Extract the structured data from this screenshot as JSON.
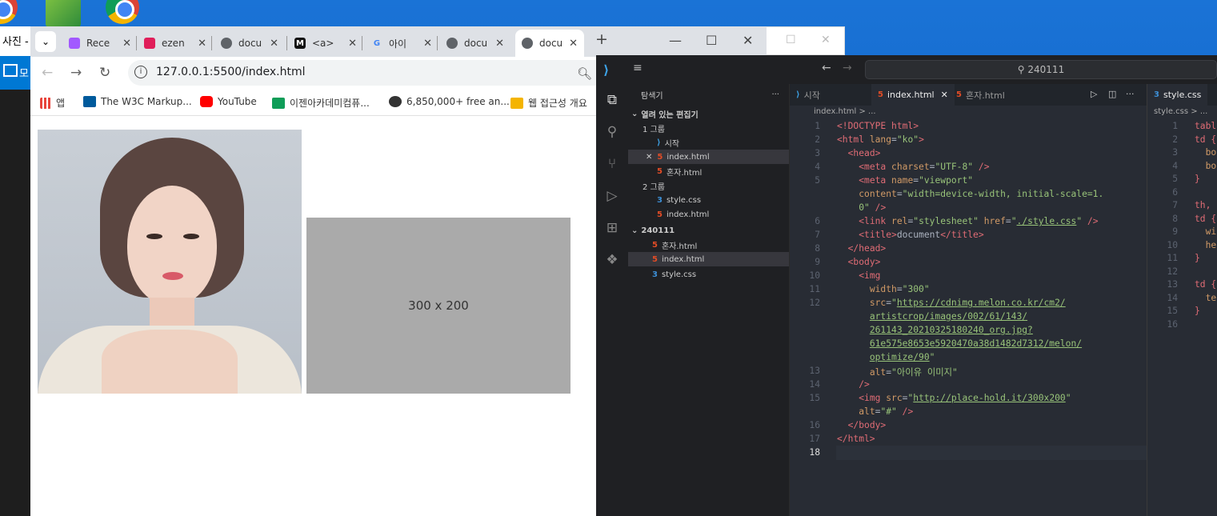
{
  "desktop": {
    "photo_app_title": "사진 -",
    "photo_app_bar": "모"
  },
  "chrome": {
    "tabs": [
      {
        "label": "Rece",
        "icon": "figma-icon",
        "color": "#a259ff"
      },
      {
        "label": "ezen",
        "icon": "slack-icon",
        "color": "#e01e5a"
      },
      {
        "label": "docu",
        "icon": "globe-icon",
        "color": "#5f6368"
      },
      {
        "label": "<a>",
        "icon": "m-icon",
        "color": "#111111"
      },
      {
        "label": "아이",
        "icon": "google-icon",
        "color": "#4285f4"
      },
      {
        "label": "docu",
        "icon": "globe-icon",
        "color": "#5f6368"
      },
      {
        "label": "docu",
        "icon": "globe-icon",
        "color": "#5f6368"
      }
    ],
    "url": "127.0.0.1:5500/index.html",
    "bookmarks": [
      {
        "label": "앱",
        "color": "#e8453c"
      },
      {
        "label": "The W3C Markup...",
        "color": "#005a9c"
      },
      {
        "label": "YouTube",
        "color": "#ff0000"
      },
      {
        "label": "이젠아카데미컴퓨...",
        "color": "#0f9d58"
      },
      {
        "label": "6,850,000+ free an...",
        "color": "#333333"
      },
      {
        "label": "웹 접근성 개요",
        "color": "#f4b400"
      }
    ],
    "page": {
      "placeholder_text": "300 x 200"
    }
  },
  "vscode": {
    "search": "240111",
    "explorer_title": "탐색기",
    "open_editors": "열려 있는 편집기",
    "group1": "1 그룹",
    "group2": "2 그룹",
    "folder": "240111",
    "files": {
      "start": "시작",
      "index": "index.html",
      "honja": "혼자.html",
      "style": "style.css"
    },
    "tabs": [
      "시작",
      "index.html",
      "혼자.html"
    ],
    "split_tab": "style.css",
    "breadcrumb": "index.html > ...",
    "split_breadcrumb": "style.css > ...",
    "split_lines": [
      "tabl",
      "td {",
      "  bo",
      "  bo",
      "}",
      "",
      "th,",
      "td {",
      "  wi",
      "  he",
      "}",
      "",
      "td {",
      "  te",
      "}",
      ""
    ]
  }
}
